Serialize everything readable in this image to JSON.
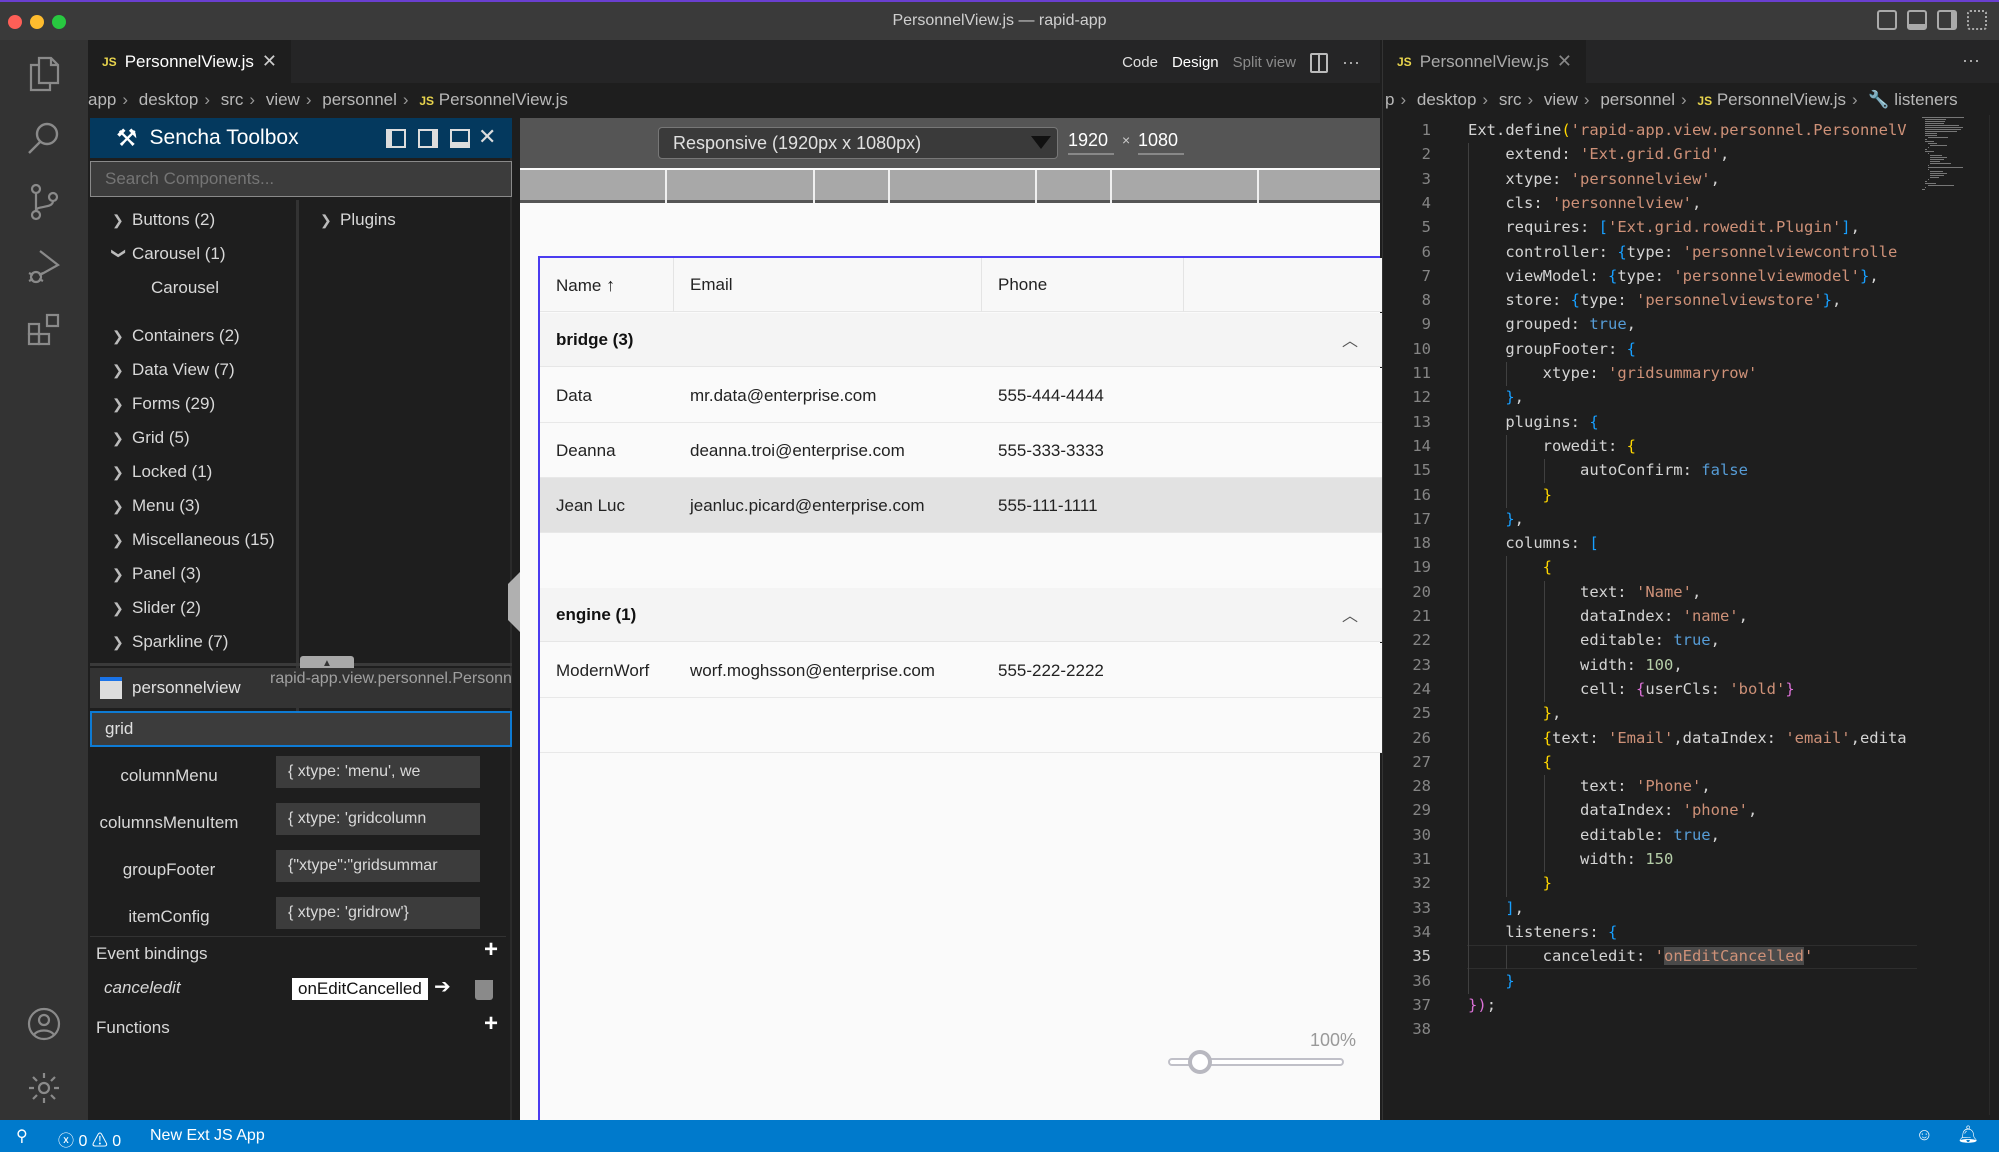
{
  "window": {
    "title": "PersonnelView.js — rapid-app"
  },
  "editor_left": {
    "tab": {
      "label": "PersonnelView.js",
      "lang": "JS"
    },
    "view_modes": [
      "Code",
      "Design",
      "Split view"
    ],
    "active_view_mode": "Design",
    "breadcrumb": [
      "app",
      "desktop",
      "src",
      "view",
      "personnel",
      "PersonnelView.js"
    ]
  },
  "toolbox": {
    "title": "Sencha Toolbox",
    "search_placeholder": "Search Components...",
    "categories": [
      {
        "label": "Buttons (2)",
        "expanded": false
      },
      {
        "label": "Carousel (1)",
        "expanded": true,
        "children": [
          "Carousel"
        ]
      },
      {
        "label": "Containers (2)",
        "expanded": false
      },
      {
        "label": "Data View (7)",
        "expanded": false
      },
      {
        "label": "Forms (29)",
        "expanded": false
      },
      {
        "label": "Grid (5)",
        "expanded": false
      },
      {
        "label": "Locked (1)",
        "expanded": false
      },
      {
        "label": "Menu (3)",
        "expanded": false
      },
      {
        "label": "Miscellaneous (15)",
        "expanded": false
      },
      {
        "label": "Panel (3)",
        "expanded": false
      },
      {
        "label": "Slider (2)",
        "expanded": false
      },
      {
        "label": "Sparkline (7)",
        "expanded": false
      }
    ],
    "right_tree": [
      {
        "label": "Plugins",
        "expanded": false
      }
    ],
    "selected_component": {
      "xtype": "personnelview",
      "class": "rapid-app.view.personnel.PersonnelView"
    },
    "property_filter": "grid",
    "properties": [
      {
        "name": "columnMenu",
        "value": "{   xtype: 'menu',    we"
      },
      {
        "name": "columnsMenuItem",
        "value": "{   xtype: 'gridcolumn"
      },
      {
        "name": "groupFooter",
        "value": "{\"xtype\":\"gridsummar"
      },
      {
        "name": "itemConfig",
        "value": "{   xtype: 'gridrow'}"
      }
    ],
    "event_bindings_label": "Event bindings",
    "event_bindings": [
      {
        "event": "canceledit",
        "handler": "onEditCancelled"
      }
    ],
    "functions_label": "Functions"
  },
  "designer": {
    "device": "Responsive (1920px x 1080px)",
    "width": "1920",
    "height": "1080",
    "times": "×",
    "grid": {
      "columns": [
        "Name",
        "Email",
        "Phone"
      ],
      "sort_column": "Name",
      "sort_dir": "asc",
      "groups": [
        {
          "label": "bridge (3)",
          "rows": [
            {
              "name": "Data",
              "email": "mr.data@enterprise.com",
              "phone": "555-444-4444"
            },
            {
              "name": "Deanna",
              "email": "deanna.troi@enterprise.com",
              "phone": "555-333-3333"
            },
            {
              "name": "Jean Luc",
              "email": "jeanluc.picard@enterprise.com",
              "phone": "555-111-1111",
              "selected": true
            }
          ]
        },
        {
          "label": "engine (1)",
          "rows": [
            {
              "name": "ModernWorf",
              "email": "worf.moghsson@enterprise.com",
              "phone": "555-222-2222"
            }
          ]
        }
      ]
    },
    "zoom": {
      "label": "100%",
      "value_percent": 100
    }
  },
  "editor_right": {
    "tab": {
      "label": "PersonnelView.js",
      "lang": "JS"
    },
    "breadcrumb": [
      "p",
      "desktop",
      "src",
      "view",
      "personnel",
      "PersonnelView.js",
      "listeners"
    ],
    "current_line": 35,
    "lines": [
      "Ext.define('rapid-app.view.personnel.PersonnelV",
      "    extend: 'Ext.grid.Grid',",
      "    xtype: 'personnelview',",
      "    cls: 'personnelview',",
      "    requires: ['Ext.grid.rowedit.Plugin'],",
      "    controller: {type: 'personnelviewcontrolle",
      "    viewModel: {type: 'personnelviewmodel'},",
      "    store: {type: 'personnelviewstore'},",
      "    grouped: true,",
      "    groupFooter: {",
      "        xtype: 'gridsummaryrow'",
      "    },",
      "    plugins: {",
      "        rowedit: {",
      "            autoConfirm: false",
      "        }",
      "    },",
      "    columns: [",
      "        {",
      "            text: 'Name',",
      "            dataIndex: 'name',",
      "            editable: true,",
      "            width: 100,",
      "            cell: {userCls: 'bold'}",
      "        },",
      "        {text: 'Email',dataIndex: 'email',edita",
      "        {",
      "            text: 'Phone',",
      "            dataIndex: 'phone',",
      "            editable: true,",
      "            width: 150",
      "        }",
      "    ],",
      "    listeners: {",
      "        canceledit: 'onEditCancelled'",
      "    }",
      "});",
      ""
    ]
  },
  "status_bar": {
    "errors": "0",
    "warnings": "0",
    "project": "New Ext JS App"
  },
  "colors": {
    "accent_blue": "#007acc",
    "toolbox_header": "#04395e",
    "grid_selection_border": "#4b3cf0",
    "selected_row": "#e2e2e2"
  }
}
